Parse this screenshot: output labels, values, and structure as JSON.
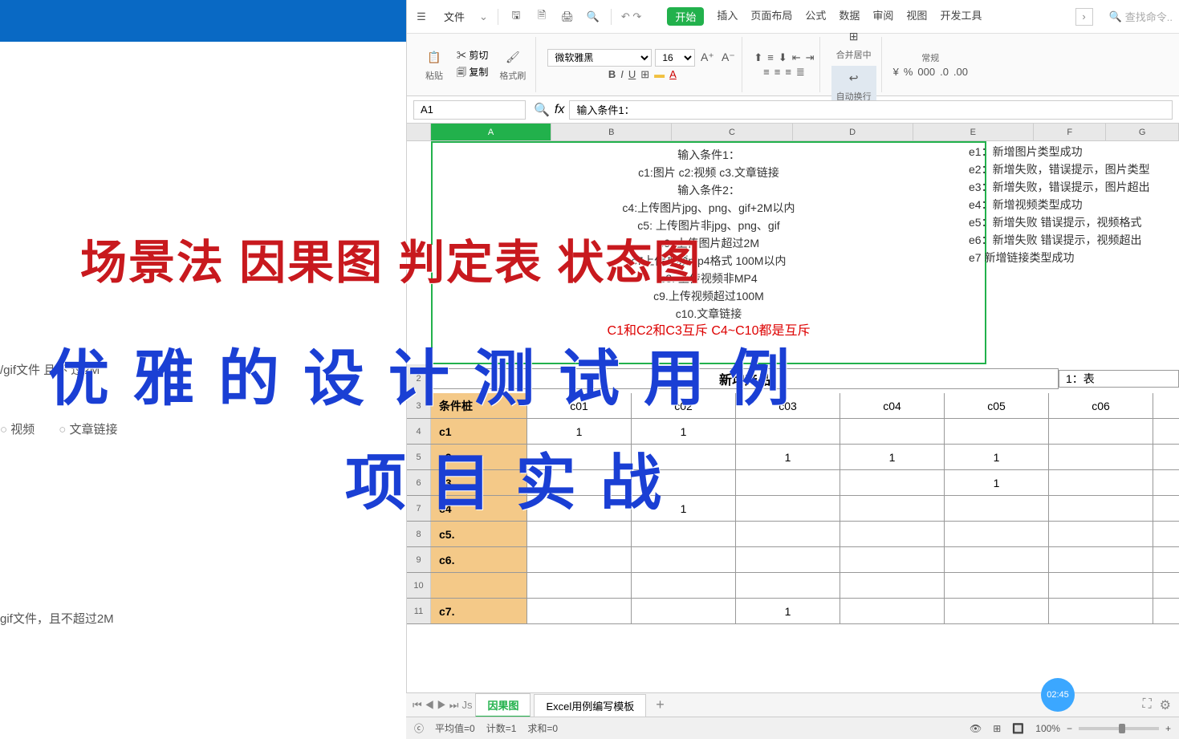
{
  "overlay": {
    "red_line": "场景法 因果图 判定表 状态图",
    "blue_line1": "优雅的设计测试用例",
    "blue_line2": "项目实战"
  },
  "left": {
    "gif_note": "/gif文件  且不  过2M",
    "radio_video": "视频",
    "radio_link": "文章链接",
    "gif_note2": "gif文件，且不超过2M"
  },
  "menu": {
    "file": "文件",
    "search_placeholder": "查找命令..",
    "tabs": [
      "开始",
      "插入",
      "页面布局",
      "公式",
      "数据",
      "审阅",
      "视图",
      "开发工具"
    ]
  },
  "ribbon": {
    "paste": "粘贴",
    "cut": "剪切",
    "copy": "复制",
    "format": "格式刷",
    "font_name": "微软雅黑",
    "font_size": "16",
    "merge": "合并居中",
    "wrap": "自动换行",
    "general": "常规"
  },
  "namebox": "A1",
  "formula_value": "输入条件1：",
  "cols": [
    "A",
    "B",
    "C",
    "D",
    "E",
    "F",
    "G"
  ],
  "upper_lines": [
    "输入条件1：",
    "c1:图片   c2:视频  c3.文章链接",
    "输入条件2：",
    "c4:上传图片jpg、png、gif+2M以内",
    "c5: 上传图片非jpg、png、gif",
    "c6: 上传图片超过2M",
    "c7上传视频mp4格式  100M以内",
    "c8. 上传视频非MP4",
    "c9.上传视频超过100M",
    "c10.文章链接"
  ],
  "upper_red": "C1和C2和C3互斥    C4~C10都是互斥",
  "right_notes": [
    "e1：新增图片类型成功",
    "e2：新增失败，错误提示，图片类型",
    "e3：新增失败，错误提示，图片超出",
    "e4：新增视频类型成功",
    "e5：新增失败   错误提示，视频格式",
    "e6：新增失败   错误提示，视频超出",
    "e7   新增链接类型成功"
  ],
  "table_title": "新增产品",
  "table_extra": "1：表",
  "col_headers": [
    "条件桩",
    "c01",
    "c02",
    "c03",
    "c04",
    "c05",
    "c06"
  ],
  "rows": [
    {
      "n": "4",
      "label": "c1",
      "v": [
        "1",
        "1",
        "",
        "",
        "",
        ""
      ]
    },
    {
      "n": "5",
      "label": "c2",
      "v": [
        "",
        "",
        "1",
        "1",
        "1",
        ""
      ]
    },
    {
      "n": "6",
      "label": "c3",
      "v": [
        "",
        "",
        "",
        "",
        "1",
        ""
      ]
    },
    {
      "n": "7",
      "label": "c4",
      "v": [
        "",
        "1",
        "",
        "",
        "",
        ""
      ]
    },
    {
      "n": "8",
      "label": "c5.",
      "v": [
        "",
        "",
        "",
        "",
        "",
        ""
      ]
    },
    {
      "n": "9",
      "label": "c6.",
      "v": [
        "",
        "",
        "",
        "",
        "",
        ""
      ]
    },
    {
      "n": "10",
      "label": "",
      "v": [
        "",
        "",
        "",
        "",
        "",
        ""
      ]
    },
    {
      "n": "11",
      "label": "c7.",
      "v": [
        "",
        "",
        "1",
        "",
        "",
        ""
      ]
    }
  ],
  "row_nums_top": [
    "2",
    "3"
  ],
  "sheet_tabs": {
    "active": "因果图",
    "other": "Excel用例编写模板"
  },
  "status": {
    "avg": "平均值=0",
    "count": "计数=1",
    "sum": "求和=0",
    "zoom": "100%"
  },
  "time_badge": "02:45"
}
